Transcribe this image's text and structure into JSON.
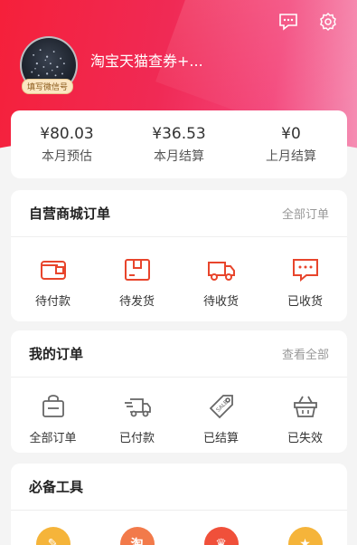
{
  "header": {
    "username": "淘宝天猫查券+...",
    "avatar_badge": "填写微信号"
  },
  "stats": [
    {
      "value": "¥80.03",
      "label": "本月预估"
    },
    {
      "value": "¥36.53",
      "label": "本月结算"
    },
    {
      "value": "¥0",
      "label": "上月结算"
    }
  ],
  "mall_orders": {
    "title": "自营商城订单",
    "link": "全部订单",
    "items": [
      {
        "label": "待付款",
        "icon": "wallet-icon"
      },
      {
        "label": "待发货",
        "icon": "package-icon"
      },
      {
        "label": "待收货",
        "icon": "truck-icon"
      },
      {
        "label": "已收货",
        "icon": "chat-check-icon"
      }
    ]
  },
  "my_orders": {
    "title": "我的订单",
    "link": "查看全部",
    "items": [
      {
        "label": "全部订单",
        "icon": "bag-icon"
      },
      {
        "label": "已付款",
        "icon": "delivery-icon"
      },
      {
        "label": "已结算",
        "icon": "sale-tag-icon"
      },
      {
        "label": "已失效",
        "icon": "basket-icon"
      }
    ]
  },
  "tools": {
    "title": "必备工具",
    "items": [
      {
        "icon": "edit-icon",
        "color": "#f5b43a",
        "glyph": "✎"
      },
      {
        "icon": "tao-icon",
        "color": "#f27a4a",
        "glyph": "淘"
      },
      {
        "icon": "crown-icon",
        "color": "#f0503a",
        "glyph": "♛"
      },
      {
        "icon": "star-icon",
        "color": "#f5b43a",
        "glyph": "★"
      }
    ]
  },
  "colors": {
    "accent": "#e8452c",
    "gray_icon": "#666666"
  }
}
